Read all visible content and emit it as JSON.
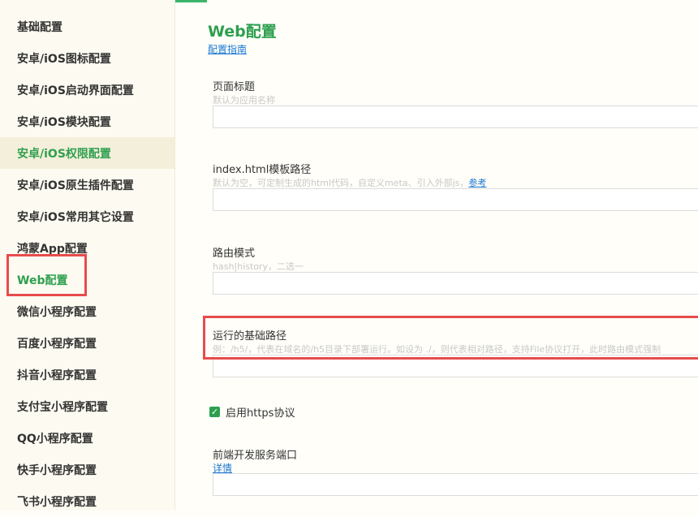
{
  "colors": {
    "accent": "#2e9f4f",
    "highlight_box": "#e84b4b",
    "link": "#1a77d2"
  },
  "sidebar": {
    "items": [
      {
        "label": "基础配置"
      },
      {
        "label": "安卓/iOS图标配置"
      },
      {
        "label": "安卓/iOS启动界面配置"
      },
      {
        "label": "安卓/iOS模块配置"
      },
      {
        "label": "安卓/iOS权限配置"
      },
      {
        "label": "安卓/iOS原生插件配置"
      },
      {
        "label": "安卓/iOS常用其它设置"
      },
      {
        "label": "鸿蒙App配置"
      },
      {
        "label": "Web配置"
      },
      {
        "label": "微信小程序配置"
      },
      {
        "label": "百度小程序配置"
      },
      {
        "label": "抖音小程序配置"
      },
      {
        "label": "支付宝小程序配置"
      },
      {
        "label": "QQ小程序配置"
      },
      {
        "label": "快手小程序配置"
      },
      {
        "label": "飞书小程序配置"
      }
    ]
  },
  "main": {
    "title": "Web配置",
    "guide_link": "配置指南",
    "fields": {
      "page_title": {
        "label": "页面标题",
        "hint": "默认为应用名称",
        "value": ""
      },
      "template_path": {
        "label": "index.html模板路径",
        "hint": "默认为空，可定制生成的html代码，自定义meta、引入外部js，",
        "hint_link": "参考",
        "value": ""
      },
      "router_mode": {
        "label": "路由模式",
        "hint": "hash|history，二选一",
        "value": ""
      },
      "base_path": {
        "label": "运行的基础路径",
        "hint": "例：/h5/，代表在域名的/h5目录下部署运行。如设为 ./，则代表相对路径，支持File协议打开，此时路由模式强制",
        "value": ""
      },
      "https": {
        "label": "启用https协议",
        "checked": true
      },
      "dev_port": {
        "label": "前端开发服务端口",
        "link": "详情",
        "value": ""
      }
    }
  }
}
